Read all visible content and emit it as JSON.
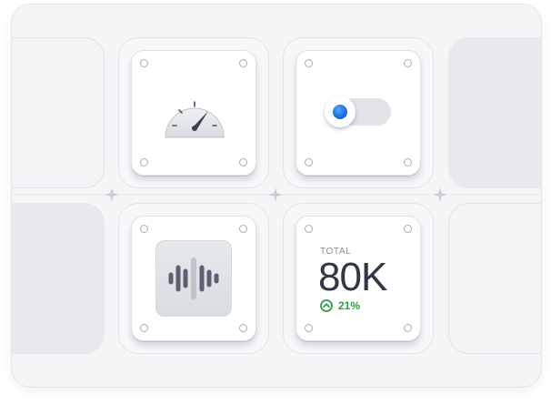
{
  "stat_tile": {
    "label": "TOTAL",
    "value": "80K",
    "change": "21%",
    "trend": "up"
  },
  "colors": {
    "background": "#f4f5f7",
    "tile": "#ffffff",
    "text_dark": "#2f3744",
    "positive": "#2f9a48",
    "toggle_accent": "#1b6fe0"
  },
  "icons": {
    "gauge": "gauge-icon",
    "toggle": "toggle-switch",
    "audio": "audio-waveform-icon",
    "trend": "arrow-up-circle-icon",
    "spacer": "sparkle-icon"
  }
}
